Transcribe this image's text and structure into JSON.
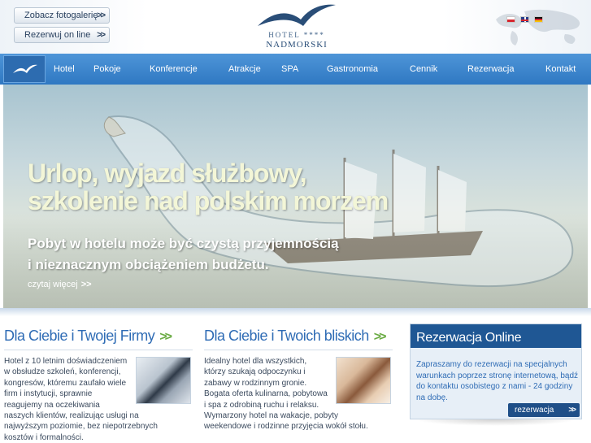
{
  "header": {
    "gallery_button": "Zobacz fotogalerię",
    "book_button": "Rezerwuj on line",
    "logo_line1": "HOTEL ****",
    "logo_line2": "NADMORSKI",
    "languages": [
      "pl",
      "en",
      "de"
    ]
  },
  "nav": {
    "items": [
      "Hotel",
      "Pokoje",
      "Konferencje",
      "Atrakcje",
      "SPA",
      "Gastronomia",
      "Cennik",
      "Rezerwacja",
      "Kontakt"
    ]
  },
  "hero": {
    "headline_line1": "Urlop, wyjazd służbowy,",
    "headline_line2": "szkolenie nad polskim morzem",
    "sub_line1": "Pobyt w hotelu może być czystą przyjemnością",
    "sub_line2": "i nieznacznym obciążeniem budżetu.",
    "read_more": "czytaj więcej"
  },
  "business": {
    "title": "Dla Ciebie i Twojej Firmy",
    "lines": [
      "Hotel z 10 letnim doświadczeniem",
      "w obsłudze szkoleń, konferencji,",
      "kongresów, któremu zaufało wiele",
      "firm i instytucji, sprawnie",
      "reagujemy na oczekiwania",
      "naszych klientów, realizując usługi na",
      "najwyższym poziomie, bez niepotrzebnych",
      "kosztów i formalności."
    ]
  },
  "family": {
    "title": "Dla Ciebie i Twoich bliskich",
    "lines": [
      "Idealny hotel dla wszystkich,",
      "którzy szukają odpoczynku i",
      "zabawy w rodzinnym gronie.",
      "Bogata oferta kulinarna, pobytowa",
      "i spa z odrobiną ruchu i relaksu.",
      "Wymarzony hotel na wakacje, pobyty",
      "weekendowe i rodzinne przyjęcia wokół stołu."
    ]
  },
  "reservation": {
    "title": "Rezerwacja Online",
    "text": "Zapraszamy do rezerwacji na specjalnych warunkach poprzez stronę internetową, bądź do kontaktu osobistego z nami - 24 godziny na dobę.",
    "button": "rezerwacja"
  },
  "colors": {
    "nav_blue": "#3a84cc",
    "title_blue": "#2f6cb5",
    "accent_green": "#6aab43",
    "res_header": "#1f5794"
  }
}
